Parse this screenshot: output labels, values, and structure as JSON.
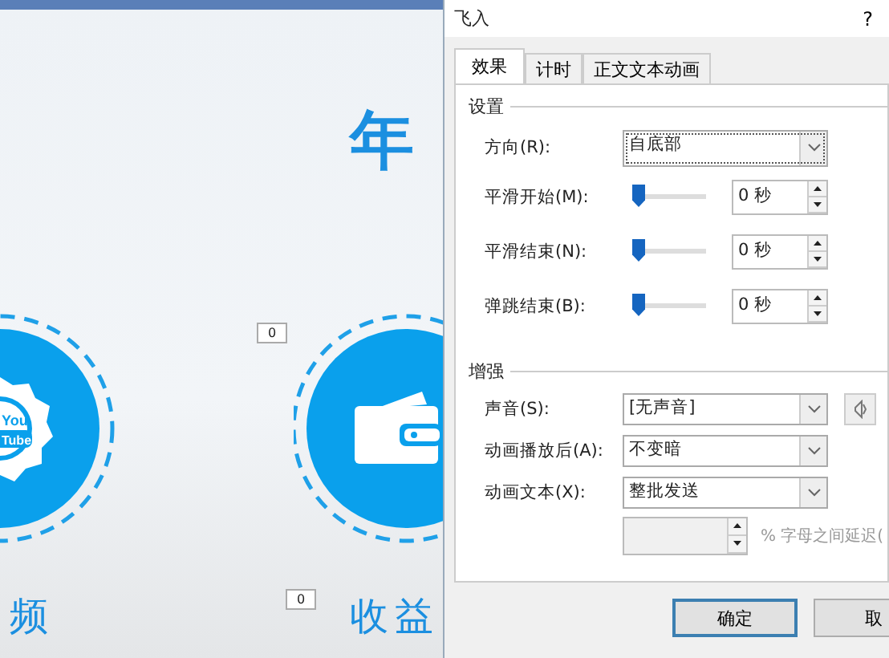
{
  "slide": {
    "title": "年",
    "badge_text": [
      "You",
      "Tube"
    ],
    "labels": [
      "频",
      "收益"
    ],
    "counters": [
      "0",
      "0"
    ]
  },
  "dialog": {
    "title": "飞入",
    "help": "?",
    "tabs": [
      {
        "label": "效果",
        "selected": true
      },
      {
        "label": "计时",
        "selected": false
      },
      {
        "label": "正文文本动画",
        "selected": false
      }
    ],
    "groups": [
      {
        "title": "设置",
        "rows": [
          {
            "kind": "dropdown",
            "label": "方向(R):",
            "value": "自底部",
            "focused": true
          },
          {
            "kind": "slider",
            "label": "平滑开始(M):",
            "level": 0,
            "value": "0 秒"
          },
          {
            "kind": "slider",
            "label": "平滑结束(N):",
            "level": 0,
            "value": "0 秒"
          },
          {
            "kind": "slider",
            "label": "弹跳结束(B):",
            "level": 0,
            "value": "0 秒"
          }
        ]
      },
      {
        "title": "增强",
        "rows": [
          {
            "kind": "sound",
            "label": "声音(S):",
            "value": "[无声音]"
          },
          {
            "kind": "dropdown",
            "label": "动画播放后(A):",
            "value": "不变暗",
            "focused": false
          },
          {
            "kind": "dropdown",
            "label": "动画文本(X):",
            "value": "整批发送",
            "focused": false
          },
          {
            "kind": "spin",
            "label": "",
            "disabled": true,
            "suffix": "% 字母之间延迟("
          }
        ]
      }
    ],
    "buttons": [
      {
        "label": "确定",
        "default": true
      },
      {
        "label": "取",
        "default": false
      }
    ]
  }
}
